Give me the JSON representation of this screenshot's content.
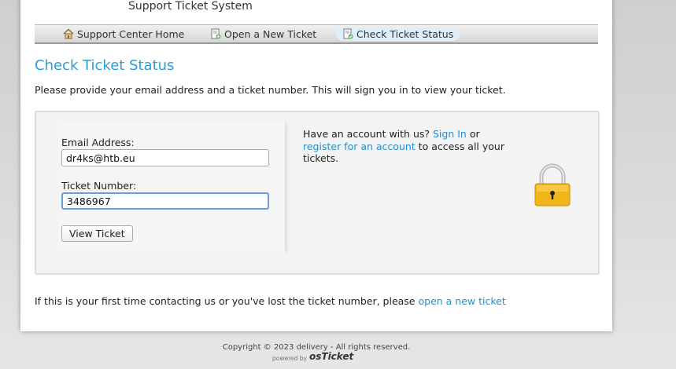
{
  "header": {
    "subtitle": "Support Ticket System"
  },
  "nav": {
    "items": [
      {
        "label": "Support Center Home",
        "icon": "home-icon"
      },
      {
        "label": "Open a New Ticket",
        "icon": "new-ticket-icon"
      },
      {
        "label": "Check Ticket Status",
        "icon": "ticket-status-icon",
        "active": true
      }
    ]
  },
  "page": {
    "title": "Check Ticket Status",
    "intro": "Please provide your email address and a ticket number. This will sign you in to view your ticket."
  },
  "form": {
    "email_label": "Email Address:",
    "email_value": "dr4ks@htb.eu",
    "ticket_label": "Ticket Number:",
    "ticket_value": "3486967",
    "submit_label": "View Ticket"
  },
  "side": {
    "text_1": "Have an account with us?",
    "sign_in": "Sign In",
    "text_2": "or",
    "register": "register for an account",
    "text_3": "to access all your tickets."
  },
  "footer": {
    "note": "If this is your first time contacting us or you've lost the ticket number, please",
    "note_link": "open a new ticket",
    "copyright": "Copyright © 2023 delivery - All rights reserved.",
    "powered_by": "powered by",
    "brand": "osTicket"
  },
  "colors": {
    "accent": "#2a9fd6",
    "link": "#1e90d6"
  }
}
